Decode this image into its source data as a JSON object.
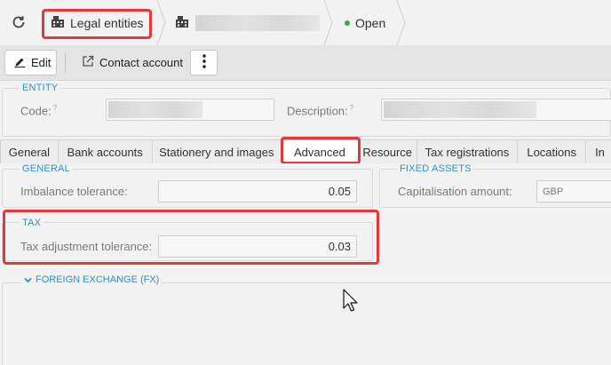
{
  "breadcrumb": {
    "legal_entities_label": "Legal entities",
    "status_label": "Open",
    "status_color": "#3fa64a"
  },
  "toolbar": {
    "edit_label": "Edit",
    "contact_label": "Contact account"
  },
  "entity": {
    "section_title": "ENTITY",
    "code_label": "Code:",
    "code_hint": "?",
    "description_label": "Description:",
    "description_hint": "?"
  },
  "tabs": [
    {
      "label": "General"
    },
    {
      "label": "Bank accounts"
    },
    {
      "label": "Stationery and images"
    },
    {
      "label": "Advanced",
      "active": true
    },
    {
      "label": "Resource"
    },
    {
      "label": "Tax registrations"
    },
    {
      "label": "Locations"
    },
    {
      "label": "In"
    }
  ],
  "advanced": {
    "general": {
      "title": "GENERAL",
      "imbalance_label": "Imbalance tolerance:",
      "imbalance_value": "0.05"
    },
    "fixed_assets": {
      "title": "FIXED ASSETS",
      "capitalisation_label": "Capitalisation amount:",
      "capitalisation_currency": "GBP"
    },
    "tax": {
      "title": "TAX",
      "adjustment_label": "Tax adjustment tolerance:",
      "adjustment_value": "0.03"
    },
    "fx": {
      "title": "FOREIGN EXCHANGE (FX)"
    }
  },
  "colors": {
    "highlight": "#e03a3e",
    "section_title": "#2f8fce"
  }
}
